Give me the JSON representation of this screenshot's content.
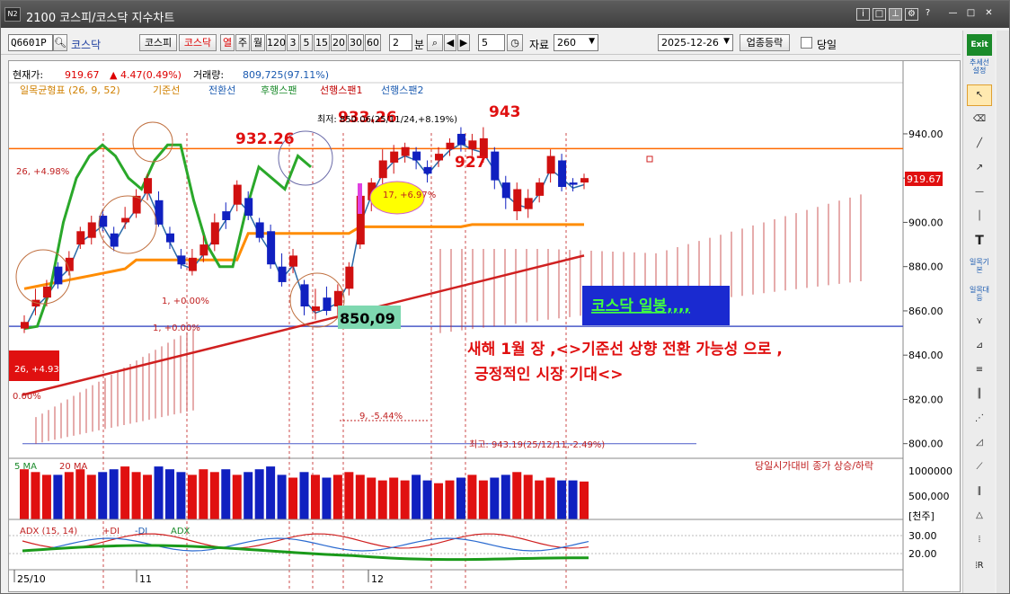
{
  "window": {
    "title": "2100 코스피/코스닥 지수차트",
    "logo": "N2"
  },
  "toolbar": {
    "code": "Q6601P",
    "market_label": "코스닥",
    "btn_kospi": "코스피",
    "btn_kosdaq": "코스닥",
    "period_buttons": [
      "열",
      "주",
      "월",
      "120",
      "3",
      "5",
      "15",
      "20",
      "30",
      "60"
    ],
    "period_value": "2",
    "unit": "분",
    "count": "5",
    "data_label": "자료",
    "data_value": "260",
    "date": "2025-12-26",
    "sector_btn": "업종등락",
    "check_label": "당일"
  },
  "quote": {
    "price_label": "현재가:",
    "price": "919.67",
    "change": "▲ 4.47(0.49%)",
    "volume_label": "거래량:",
    "volume": "809,725(97.11%)"
  },
  "legend": {
    "ichimoku": "일목균형표 (26, 9, 52)",
    "base": "기준선",
    "conv": "전환선",
    "lag": "후행스팬",
    "lead1": "선행스팬1",
    "lead2": "선행스팬2"
  },
  "y_axis": [
    "940.00",
    "920.00",
    "900.00",
    "880.00",
    "860.00",
    "840.00",
    "820.00",
    "800.00"
  ],
  "current_price_tag": "919.67",
  "annotations": {
    "high_label": "943",
    "label_932": "932.26",
    "label_933": "933.26",
    "label_927": "927",
    "label_850": "850,09",
    "max_text": "최저: 850.06(25/11/24,+8.19%)",
    "min_text": "최고: 943.19(25/12/11,-2.49%)",
    "box_label": "코스닥 일봉,,,,",
    "comment1": "새해 1월 장 ,<>기준선 상향 전환 가능성 으로 ,",
    "comment2": "긍정적인 시장 기대<>",
    "pct1": "26, +4.98%",
    "pct2": "26, +4.93%",
    "pct3": "17, +6.97%",
    "pct4": "9, -5.44%",
    "pct5": "1, +0.00%",
    "pct6": "1, +0.00%",
    "pct7": "0.00%"
  },
  "volume": {
    "legend_ma5": "5 MA",
    "legend_ma20": "20 MA",
    "right_text": "당일시가대비 종가 상승/하락",
    "axis": [
      "1000000",
      "500,000",
      "[천주]"
    ]
  },
  "adx": {
    "legend": "ADX (15, 14)",
    "plus": "+DI",
    "minus": "-DI",
    "adx": "ADX",
    "axis": [
      "30.00",
      "20.00"
    ]
  },
  "x_axis": [
    "25/10",
    "11",
    "12"
  ],
  "side_tools": [
    "Exit",
    "추세선설정",
    "일목기본",
    "일목대등"
  ],
  "chart_data": {
    "type": "candlestick",
    "title": "",
    "xlabel": "",
    "ylabel": "",
    "ylim": [
      795,
      955
    ],
    "grid": false,
    "candles": [
      [
        855,
        852,
        850,
        858,
        "u"
      ],
      [
        862,
        865,
        858,
        870,
        "u"
      ],
      [
        866,
        871,
        862,
        874,
        "u"
      ],
      [
        872,
        880,
        870,
        882,
        "d"
      ],
      [
        878,
        884,
        876,
        887,
        "u"
      ],
      [
        890,
        896,
        888,
        898,
        "u"
      ],
      [
        893,
        900,
        890,
        903,
        "u"
      ],
      [
        898,
        903,
        896,
        906,
        "d"
      ],
      [
        895,
        889,
        887,
        898,
        "d"
      ],
      [
        900,
        902,
        897,
        907,
        "u"
      ],
      [
        904,
        912,
        902,
        915,
        "u"
      ],
      [
        913,
        920,
        910,
        922,
        "u"
      ],
      [
        910,
        899,
        898,
        914,
        "d"
      ],
      [
        895,
        891,
        888,
        898,
        "d"
      ],
      [
        885,
        881,
        879,
        888,
        "d"
      ],
      [
        878,
        884,
        876,
        888,
        "u"
      ],
      [
        885,
        890,
        882,
        894,
        "u"
      ],
      [
        890,
        900,
        887,
        904,
        "u"
      ],
      [
        901,
        905,
        897,
        909,
        "d"
      ],
      [
        908,
        917,
        905,
        919,
        "u"
      ],
      [
        911,
        903,
        901,
        914,
        "d"
      ],
      [
        900,
        893,
        891,
        902,
        "d"
      ],
      [
        896,
        881,
        879,
        899,
        "d"
      ],
      [
        880,
        873,
        871,
        886,
        "d"
      ],
      [
        880,
        885,
        877,
        888,
        "u"
      ],
      [
        872,
        862,
        858,
        874,
        "d"
      ],
      [
        860,
        862,
        856,
        870,
        "u"
      ],
      [
        866,
        860,
        858,
        871,
        "d"
      ],
      [
        862,
        869,
        858,
        872,
        "u"
      ],
      [
        870,
        880,
        867,
        882,
        "u"
      ],
      [
        890,
        912,
        888,
        914,
        "u"
      ],
      [
        910,
        918,
        905,
        920,
        "u"
      ],
      [
        920,
        928,
        915,
        933,
        "u"
      ],
      [
        927,
        932,
        922,
        935,
        "u"
      ],
      [
        930,
        934,
        927,
        936,
        "u"
      ],
      [
        932,
        928,
        924,
        934,
        "d"
      ],
      [
        925,
        922,
        918,
        928,
        "d"
      ],
      [
        928,
        931,
        925,
        934,
        "u"
      ],
      [
        933,
        936,
        930,
        938,
        "u"
      ],
      [
        935,
        940,
        932,
        943,
        "d"
      ],
      [
        937,
        933,
        930,
        940,
        "u"
      ],
      [
        938,
        929,
        927,
        943,
        "u"
      ],
      [
        932,
        919,
        915,
        934,
        "d"
      ],
      [
        918,
        911,
        906,
        921,
        "d"
      ],
      [
        915,
        905,
        901,
        918,
        "u"
      ],
      [
        906,
        911,
        902,
        915,
        "u"
      ],
      [
        912,
        918,
        909,
        920,
        "u"
      ],
      [
        922,
        930,
        918,
        933,
        "u"
      ],
      [
        928,
        916,
        914,
        931,
        "d"
      ],
      [
        918,
        917,
        914,
        920,
        "d"
      ],
      [
        918,
        920,
        915,
        922,
        "u"
      ]
    ]
  }
}
